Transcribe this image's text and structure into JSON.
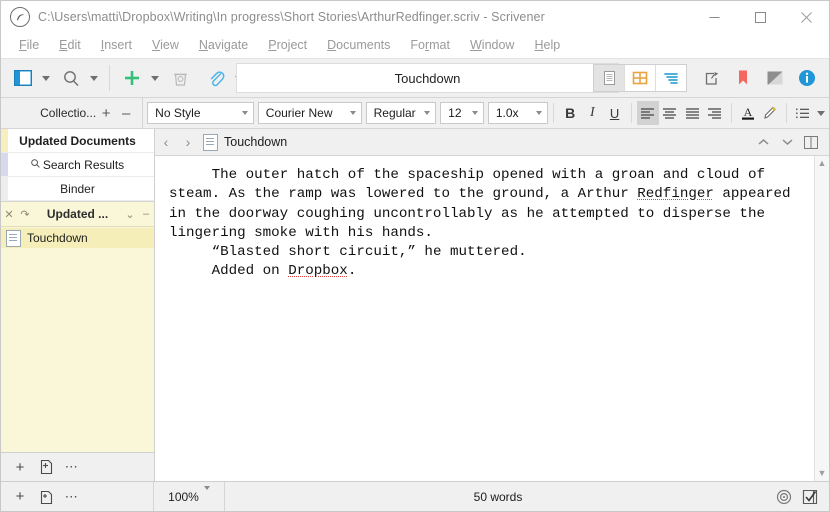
{
  "window": {
    "title": "C:\\Users\\matti\\Dropbox\\Writing\\In progress\\Short Stories\\ArthurRedfinger.scriv - Scrivener",
    "app_icon": "scrivener-logo-icon",
    "minimize_label": "Minimize",
    "maximize_label": "Maximize",
    "close_label": "Close"
  },
  "menubar": {
    "items": [
      {
        "label": "File",
        "accel": "F"
      },
      {
        "label": "Edit",
        "accel": "E"
      },
      {
        "label": "Insert",
        "accel": "I"
      },
      {
        "label": "View",
        "accel": "V"
      },
      {
        "label": "Navigate",
        "accel": "N"
      },
      {
        "label": "Project",
        "accel": "P"
      },
      {
        "label": "Documents",
        "accel": "D"
      },
      {
        "label": "Format",
        "accel": "r"
      },
      {
        "label": "Window",
        "accel": "W"
      },
      {
        "label": "Help",
        "accel": "H"
      }
    ]
  },
  "toolbar": {
    "document_title": "Touchdown",
    "buttons": [
      {
        "name": "toggle-binder-button",
        "icon": "panel-left-icon"
      },
      {
        "name": "search-button",
        "icon": "magnifier-icon"
      },
      {
        "name": "add-button",
        "icon": "plus-icon"
      },
      {
        "name": "trash-button",
        "icon": "trash-icon"
      },
      {
        "name": "attach-button",
        "icon": "paperclip-icon"
      },
      {
        "name": "compose-button",
        "icon": "pencil-note-icon"
      }
    ],
    "view_modes": [
      {
        "name": "view-mode-document",
        "icon": "document-lines-icon",
        "active": true
      },
      {
        "name": "view-mode-corkboard",
        "icon": "corkboard-grid-icon",
        "active": false
      },
      {
        "name": "view-mode-outliner",
        "icon": "outliner-lines-icon",
        "active": false
      }
    ],
    "right_buttons": [
      {
        "name": "quick-reference-button",
        "icon": "share-arrow-icon"
      },
      {
        "name": "bookmarks-button",
        "icon": "bookmark-icon"
      },
      {
        "name": "composition-mode-button",
        "icon": "split-square-icon"
      },
      {
        "name": "inspector-button",
        "icon": "info-circle-icon"
      }
    ]
  },
  "formatbar": {
    "collections_label": "Collectio...",
    "add_collection_icon": "plus-icon",
    "remove_collection_icon": "minus-icon",
    "style": "No Style",
    "font_family": "Courier New",
    "font_style": "Regular",
    "font_size": "12",
    "line_spacing": "1.0x",
    "bold_label": "B",
    "italic_label": "I",
    "underline_label": "U",
    "align": [
      {
        "name": "align-left-button",
        "active": true
      },
      {
        "name": "align-center-button",
        "active": false
      },
      {
        "name": "align-justify-button",
        "active": false
      },
      {
        "name": "align-right-button",
        "active": false
      }
    ],
    "text_color_label": "A",
    "highlight_icon": "highlighter-icon",
    "list_icon": "bullet-list-icon"
  },
  "sidebar": {
    "collection_tabs": [
      {
        "label": "Updated Documents",
        "name": "collection-tab-updated-documents",
        "selected": true
      },
      {
        "label": "Search Results",
        "name": "collection-tab-search-results",
        "icon": "magnifier-icon",
        "selected": false
      },
      {
        "label": "Binder",
        "name": "collection-tab-binder",
        "selected": false
      }
    ],
    "collection_header": {
      "title": "Updated ...",
      "close_icon": "close-x-icon",
      "refresh_icon": "refresh-arrow-icon",
      "chevron_icon": "chevron-down-icon",
      "minus_icon": "minus-icon"
    },
    "documents": [
      {
        "label": "Touchdown",
        "icon": "document-icon",
        "selected": true
      }
    ],
    "footer": {
      "add_icon": "plus-icon",
      "new_folder_icon": "new-document-icon",
      "more_icon": "ellipsis-icon"
    }
  },
  "editor": {
    "header": {
      "back_icon": "chevron-left-icon",
      "forward_icon": "chevron-right-icon",
      "doc_icon": "document-icon",
      "title": "Touchdown",
      "prev_icon": "chevron-up-icon",
      "next_icon": "chevron-down-icon",
      "split_icon": "split-view-icon"
    },
    "document_body": {
      "paragraphs": [
        {
          "indent": true,
          "runs": [
            {
              "text": "The outer hatch of the spaceship opened with a groan and cloud of steam. As the ramp was lowered to the ground, a Arthur "
            },
            {
              "text": "Redfinger",
              "misspelled": true
            },
            {
              "text": " appeared in the doorway coughing uncontrollably as he attempted to disperse the lingering smoke with his hands."
            }
          ]
        },
        {
          "indent": true,
          "runs": [
            {
              "text": "“Blasted short circuit,” he muttered."
            }
          ]
        },
        {
          "indent": true,
          "runs": [
            {
              "text": "Added on "
            },
            {
              "text": "Dropbox",
              "misspelled": true
            },
            {
              "text": "."
            }
          ]
        }
      ]
    },
    "scrollbar": {
      "up_arrow": "chevron-up-icon",
      "down_arrow": "chevron-down-icon"
    }
  },
  "statusbar": {
    "zoom": "100%",
    "word_count": "50 words",
    "target_icon": "target-icon",
    "checkbox_icon": "checkmark-box-icon"
  },
  "colors": {
    "collection_yellow": "#faf6d8",
    "row_selected": "#f5eeb9",
    "chrome_gray": "#f0f0f0",
    "accent_blue": "#2196d6",
    "accent_green": "#33c17a",
    "accent_red": "#f4685f",
    "spellcheck_red": "#e04040"
  }
}
